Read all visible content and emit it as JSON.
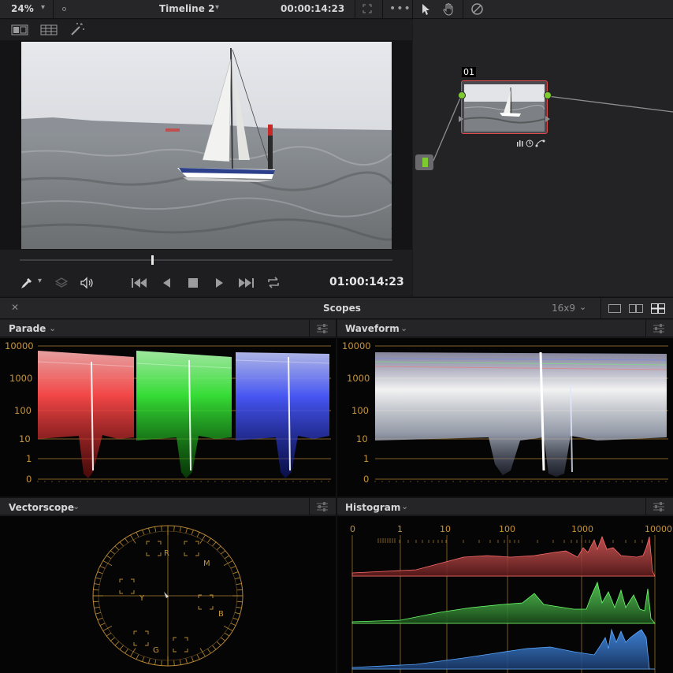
{
  "viewer": {
    "zoom": "24%",
    "timeline_name": "Timeline 2",
    "timecode_top": "00:00:14:23",
    "timecode_bottom": "01:00:14:23",
    "playhead_fraction": 0.355
  },
  "node_editor": {
    "node_label": "01"
  },
  "scopes": {
    "title": "Scopes",
    "aspect": "16x9",
    "panels": {
      "parade": "Parade",
      "waveform": "Waveform",
      "vectorscope": "Vectorscope",
      "histogram": "Histogram"
    },
    "log_ticks": [
      "10000",
      "1000",
      "100",
      "10",
      "1",
      "0"
    ],
    "histogram_ticks": [
      "0",
      "1",
      "10",
      "100",
      "1000",
      "10000"
    ],
    "vector_labels": {
      "r": "R",
      "m": "M",
      "b": "B",
      "g": "G",
      "y": "Y"
    }
  },
  "colors": {
    "accent_green": "#7ecb2f",
    "node_border": "#e54848",
    "graticule": "#c8943a",
    "red": "#ff5a5a",
    "green": "#4eff4e",
    "blue": "#5a6aff"
  }
}
